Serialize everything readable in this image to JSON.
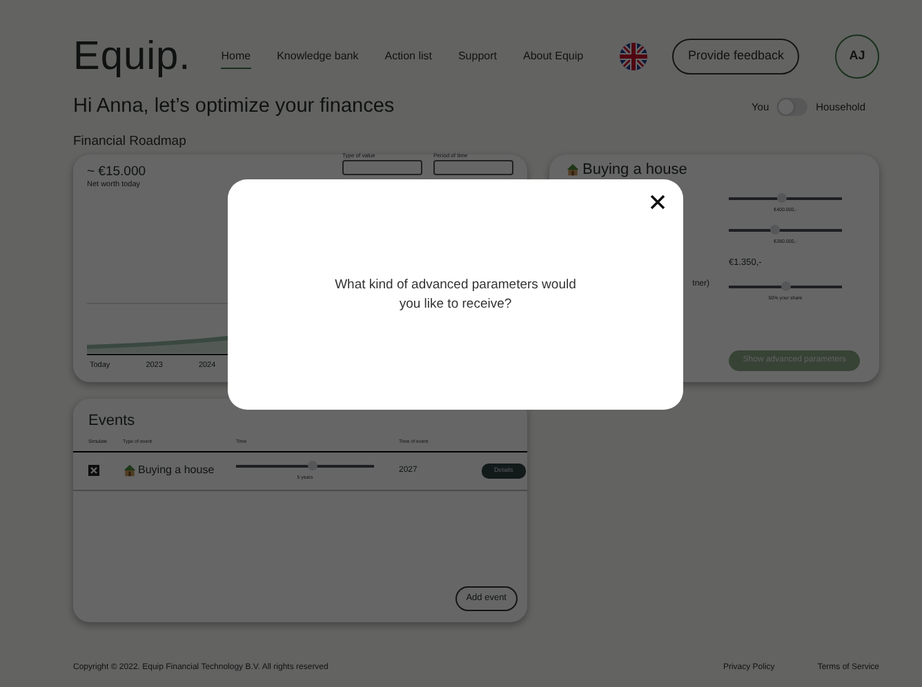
{
  "nav": {
    "logo": "Equip.",
    "links": [
      {
        "label": "Home",
        "selected": true
      },
      {
        "label": "Knowledge bank",
        "selected": false
      },
      {
        "label": "Action list",
        "selected": false
      },
      {
        "label": "Support",
        "selected": false
      },
      {
        "label": "About Equip",
        "selected": false
      }
    ],
    "feedback_button": "Provide feedback",
    "avatar": "AJ"
  },
  "greeting": "Hi Anna, let’s optimize your finances",
  "view_toggle": {
    "left": "You",
    "right": "Household",
    "on": false
  },
  "section_title": "Financial Roadmap",
  "roadmap_card": {
    "net_worth": "~ €15.000",
    "net_worth_label": "Net worth today",
    "filters": [
      {
        "label": "Type of value"
      },
      {
        "label": "Period of time"
      }
    ],
    "x_labels": [
      "Today",
      "2023",
      "2024"
    ]
  },
  "house_card": {
    "title": "Buying a house",
    "rows": [
      {
        "kind": "slider",
        "level": 0.47,
        "reading": "€400.000,-"
      },
      {
        "kind": "slider",
        "level": 0.41,
        "reading": "€280.000,-"
      },
      {
        "kind": "value",
        "value": "€1.350,-"
      },
      {
        "kind": "slider",
        "label": "tner)",
        "level": 0.5,
        "reading": "50% your share"
      }
    ],
    "button": "Show advanced parameters"
  },
  "events": {
    "title": "Events",
    "columns": [
      "Simulate",
      "Type of event",
      "Time",
      "Time of event"
    ],
    "rows": [
      {
        "checked": true,
        "event": "Buying a house",
        "level": 0.55,
        "reading": "5 years",
        "year": "2027",
        "button": "Details"
      }
    ],
    "add_button": "Add event"
  },
  "footer": {
    "copyright": "Copyright © 2022. Equip Financial Technology B.V. All rights reserved",
    "links": [
      "Privacy Policy",
      "Terms of Service"
    ]
  },
  "modal": {
    "question": "What kind of advanced parameters would you like to receive?"
  }
}
